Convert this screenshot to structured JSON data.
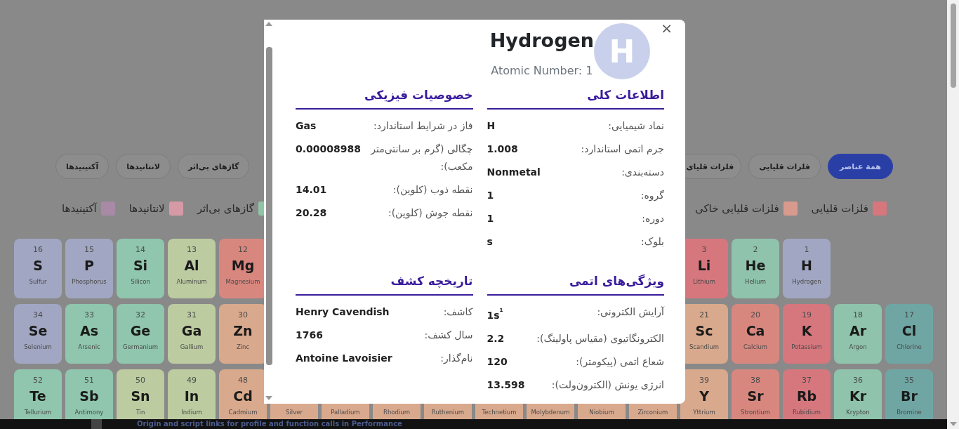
{
  "filter_chips": {
    "end": [
      {
        "label": "همة عناصر",
        "selected": true
      },
      {
        "label": "فلزات قلیایی",
        "selected": false
      },
      {
        "label": "فلزات قلیای",
        "selected": false
      }
    ],
    "start": [
      {
        "label": "گازهای بی‌اثر",
        "selected": false
      },
      {
        "label": "لانتانیدها",
        "selected": false
      },
      {
        "label": "آکتینیدها",
        "selected": false
      }
    ]
  },
  "legend": {
    "end": [
      {
        "label": "فلزات قلیایی",
        "color": "#d6777e"
      },
      {
        "label": "فلزات قلیایی خاکی",
        "color": "#d99a8e"
      }
    ],
    "start": [
      {
        "label": "گازهای بی‌اثر",
        "color": "#8fc4a6"
      },
      {
        "label": "لانتانیدها",
        "color": "#d69aa6"
      },
      {
        "label": "آکتینیدها",
        "color": "#a88aa6"
      }
    ]
  },
  "grid": [
    [
      {
        "kind": "blank"
      },
      {
        "kind": "blank"
      },
      {
        "kind": "element",
        "number": "1",
        "symbol": "H",
        "name": "Hydrogen",
        "color": "#a1a6c2"
      },
      {
        "kind": "element",
        "number": "2",
        "symbol": "He",
        "name": "Helium",
        "color": "#8fc3ab"
      },
      {
        "kind": "element",
        "number": "3",
        "symbol": "Li",
        "name": "Lithium",
        "color": "#d6777e"
      },
      {
        "kind": "blank"
      },
      {
        "kind": "blank"
      },
      {
        "kind": "blank"
      },
      {
        "kind": "blank"
      },
      {
        "kind": "blank"
      },
      {
        "kind": "blank"
      },
      {
        "kind": "blank"
      },
      {
        "kind": "blank"
      },
      {
        "kind": "element",
        "number": "12",
        "symbol": "Mg",
        "name": "Magnesium",
        "color": "#d8877f"
      },
      {
        "kind": "element",
        "number": "13",
        "symbol": "Al",
        "name": "Aluminum",
        "color": "#bccba0"
      },
      {
        "kind": "element",
        "number": "14",
        "symbol": "Si",
        "name": "Silicon",
        "color": "#8fc6ad"
      },
      {
        "kind": "element",
        "number": "15",
        "symbol": "P",
        "name": "Phosphorus",
        "color": "#a1a6c2"
      },
      {
        "kind": "element",
        "number": "16",
        "symbol": "S",
        "name": "Sulfur",
        "color": "#a1a6c2"
      }
    ],
    [
      {
        "kind": "element",
        "number": "17",
        "symbol": "Cl",
        "name": "Chlorine",
        "color": "#6fa6a3"
      },
      {
        "kind": "element",
        "number": "18",
        "symbol": "Ar",
        "name": "Argon",
        "color": "#8fc3ab"
      },
      {
        "kind": "element",
        "number": "19",
        "symbol": "K",
        "name": "Potassium",
        "color": "#d6777e"
      },
      {
        "kind": "element",
        "number": "20",
        "symbol": "Ca",
        "name": "Calcium",
        "color": "#d8877f"
      },
      {
        "kind": "element",
        "number": "21",
        "symbol": "Sc",
        "name": "Scandium",
        "color": "#d9a98d"
      },
      {
        "kind": "blank"
      },
      {
        "kind": "blank"
      },
      {
        "kind": "blank"
      },
      {
        "kind": "blank"
      },
      {
        "kind": "blank"
      },
      {
        "kind": "blank"
      },
      {
        "kind": "blank"
      },
      {
        "kind": "blank"
      },
      {
        "kind": "element",
        "number": "30",
        "symbol": "Zn",
        "name": "Zinc",
        "color": "#d9a98d"
      },
      {
        "kind": "element",
        "number": "31",
        "symbol": "Ga",
        "name": "Gallium",
        "color": "#bccba0"
      },
      {
        "kind": "element",
        "number": "32",
        "symbol": "Ge",
        "name": "Germanium",
        "color": "#8fc6ad"
      },
      {
        "kind": "element",
        "number": "33",
        "symbol": "As",
        "name": "Arsenic",
        "color": "#8fc6ad"
      },
      {
        "kind": "element",
        "number": "34",
        "symbol": "Se",
        "name": "Selenium",
        "color": "#a1a6c2"
      }
    ],
    [
      {
        "kind": "element",
        "number": "35",
        "symbol": "Br",
        "name": "Bromine",
        "color": "#6fa6a3"
      },
      {
        "kind": "element",
        "number": "36",
        "symbol": "Kr",
        "name": "Krypton",
        "color": "#8fc3ab"
      },
      {
        "kind": "element",
        "number": "37",
        "symbol": "Rb",
        "name": "Rubidium",
        "color": "#d6777e"
      },
      {
        "kind": "element",
        "number": "38",
        "symbol": "Sr",
        "name": "Strontium",
        "color": "#d8877f"
      },
      {
        "kind": "element",
        "number": "39",
        "symbol": "Y",
        "name": "Yttrium",
        "color": "#d9a98d"
      },
      {
        "kind": "element",
        "name": "Zirconium",
        "color": "#d9a98d"
      },
      {
        "kind": "element",
        "name": "Niobium",
        "color": "#d9a98d"
      },
      {
        "kind": "element",
        "name": "Molybdenum",
        "color": "#d9a98d"
      },
      {
        "kind": "element",
        "name": "Technetium",
        "color": "#d9a98d"
      },
      {
        "kind": "element",
        "name": "Ruthenium",
        "color": "#d9a98d"
      },
      {
        "kind": "element",
        "name": "Rhodium",
        "color": "#d9a98d"
      },
      {
        "kind": "element",
        "name": "Palladium",
        "color": "#d9a98d"
      },
      {
        "kind": "element",
        "name": "Silver",
        "color": "#d9a98d"
      },
      {
        "kind": "element",
        "number": "48",
        "symbol": "Cd",
        "name": "Cadmium",
        "color": "#d9a98d"
      },
      {
        "kind": "element",
        "number": "49",
        "symbol": "In",
        "name": "Indium",
        "color": "#bccba0"
      },
      {
        "kind": "element",
        "number": "50",
        "symbol": "Sn",
        "name": "Tin",
        "color": "#bccba0"
      },
      {
        "kind": "element",
        "number": "51",
        "symbol": "Sb",
        "name": "Antimony",
        "color": "#8fc6ad"
      },
      {
        "kind": "element",
        "number": "52",
        "symbol": "Te",
        "name": "Tellurium",
        "color": "#8fc6ad"
      }
    ]
  ],
  "modal": {
    "close": "×",
    "symbol": "H",
    "title": "Hydrogen",
    "subtitle": "Atomic Number: 1",
    "sections": [
      {
        "title": "اطلاعات کلی",
        "rows": [
          {
            "label": "نماد شیمیایی:",
            "value": "H"
          },
          {
            "label": "جرم اتمی استاندارد:",
            "value": "1.008"
          },
          {
            "label": "دسته‌بندی:",
            "value": "Nonmetal"
          },
          {
            "label": "گروه:",
            "value": "1"
          },
          {
            "label": "دوره:",
            "value": "1"
          },
          {
            "label": "بلوک:",
            "value": "s"
          }
        ]
      },
      {
        "title": "خصوصیات فیزیکی",
        "rows": [
          {
            "label": "فاز در شرایط استاندارد:",
            "value": "Gas"
          },
          {
            "label": "چگالی (گرم بر سانتی‌متر مکعب):",
            "value": "0.00008988"
          },
          {
            "label": "نقطه ذوب (کلوین):",
            "value": "14.01"
          },
          {
            "label": "نقطه جوش (کلوین):",
            "value": "20.28"
          }
        ]
      },
      {
        "title": "ویژگی‌های اتمی",
        "rows": [
          {
            "label": "آرایش الکترونی:",
            "value": "1s$^{¹}$"
          },
          {
            "label": "الکترونگاتیوی (مقیاس پاولینگ):",
            "value": "2.2"
          },
          {
            "label": "شعاع اتمی (پیکومتر):",
            "value": "120"
          },
          {
            "label": "انرژی یونش (الکترون‌ولت):",
            "value": "13.598"
          }
        ]
      },
      {
        "title": "تاریخچه کشف",
        "rows": [
          {
            "label": "کاشف:",
            "value": "Henry Cavendish"
          },
          {
            "label": "سال کشف:",
            "value": "1766"
          },
          {
            "label": "نام‌گذار:",
            "value": "Antoine Lavoisier"
          }
        ]
      }
    ]
  },
  "bottom_bar": {
    "text": "Origin and script links for profile and function calls in Performance"
  }
}
